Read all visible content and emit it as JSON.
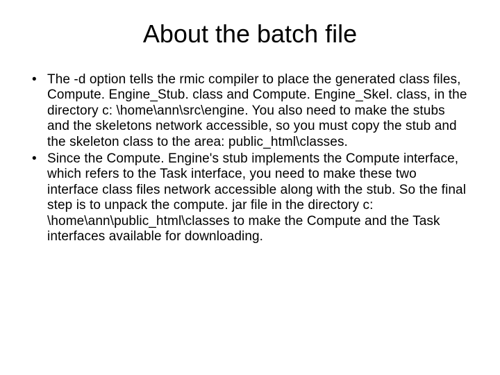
{
  "slide": {
    "title": "About the batch file",
    "bullets": [
      "The -d option tells the rmic compiler to place the generated class files, Compute. Engine_Stub. class and Compute. Engine_Skel. class, in the directory c: \\home\\ann\\src\\engine. You also need to make the stubs and the skeletons network accessible, so you must copy the stub and the skeleton class to the area: public_html\\classes.",
      "Since the Compute. Engine's stub implements the Compute interface, which refers to the Task interface, you need to make these two interface class files network accessible along with the stub. So the final step is to unpack the compute. jar file in the directory c: \\home\\ann\\public_html\\classes to make the Compute and the Task interfaces available for downloading."
    ]
  }
}
